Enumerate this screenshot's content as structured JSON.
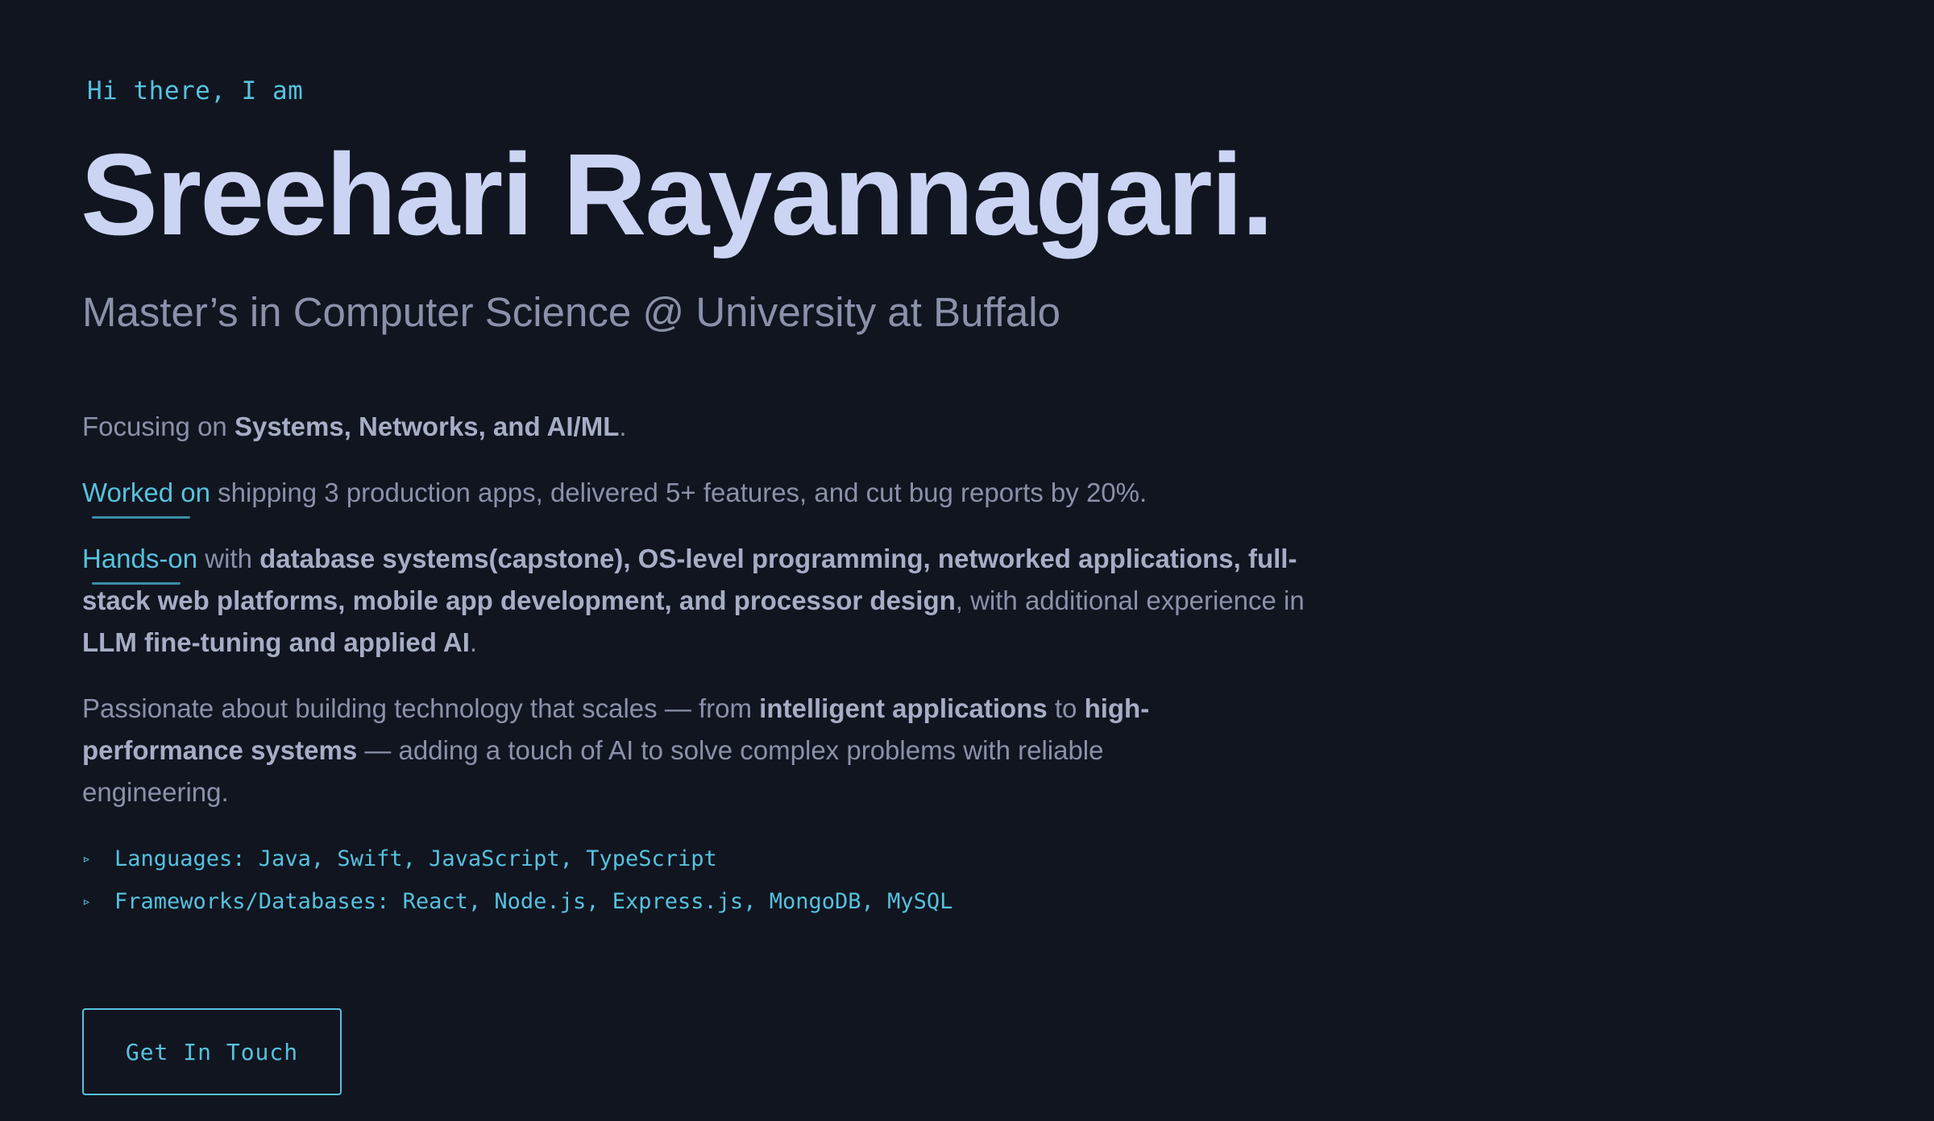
{
  "hero": {
    "greeting": "Hi there, I am",
    "name": "Sreehari Rayannagari.",
    "subtitle": "Master’s in Computer Science @ University at Buffalo"
  },
  "paragraphs": {
    "focus": {
      "prefix": "Focusing on ",
      "bold": "Systems, Networks, and AI/ML",
      "suffix": "."
    },
    "worked": {
      "link": "Worked on",
      "text": " shipping 3 production apps, delivered 5+ features, and cut bug reports by 20%."
    },
    "hands": {
      "link": "Hands-on",
      "text1": " with ",
      "bold1": "database systems(capstone), OS-level programming, networked applications, full-stack web platforms, mobile app development, and processor design",
      "text2": ", with additional experience in ",
      "bold2": "LLM fine-tuning and applied AI",
      "text3": "."
    },
    "passion": {
      "text1": "Passionate about building technology that scales — from ",
      "bold1": "intelligent applications",
      "text2": " to ",
      "bold2": "high-performance systems",
      "text3": " — adding a touch of AI to solve complex problems with reliable engineering."
    }
  },
  "skills": [
    {
      "bullet": "▹",
      "text": "Languages: Java, Swift, JavaScript, TypeScript"
    },
    {
      "bullet": "▹",
      "text": "Frameworks/Databases: React, Node.js, Express.js, MongoDB, MySQL"
    }
  ],
  "cta": {
    "label": "Get In Touch"
  },
  "colors": {
    "background": "#111520",
    "accent": "#56c2de",
    "heading": "#ccd4f3",
    "body_text": "#8b91a8",
    "bold_text": "#a7adc5"
  }
}
